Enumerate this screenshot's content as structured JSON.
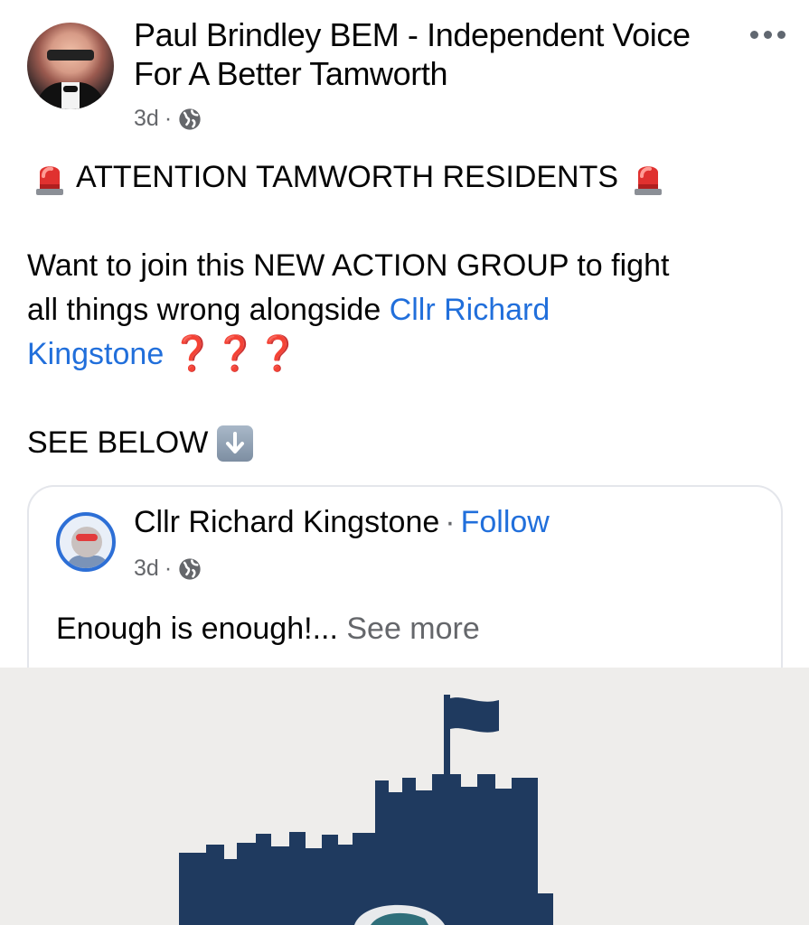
{
  "post": {
    "author": "Paul Brindley BEM - Independent Voice For A Better Tamworth",
    "time": "3d",
    "separator": "·",
    "line1": "ATTENTION TAMWORTH RESIDENTS",
    "line2a": "Want to join this NEW ACTION GROUP to fight",
    "line3a": "all things wrong alongside ",
    "mention_part1": "Cllr Richard",
    "mention_part2": "Kingstone",
    "question_marks": "❓❓❓",
    "see_below": "SEE BELOW"
  },
  "shared": {
    "name": "Cllr Richard Kingstone",
    "separator": "·",
    "follow": "Follow",
    "time": "3d",
    "text": "Enough is enough!... ",
    "see_more": "See more"
  },
  "colors": {
    "link": "#216fdb",
    "secondary_text": "#65676b",
    "castle": "#1f3a5f",
    "image_bg": "#eeedeb"
  },
  "icons": {
    "siren": "police-light-icon",
    "globe": "globe-icon",
    "arrow": "down-arrow-icon",
    "more": "more-options-icon"
  }
}
